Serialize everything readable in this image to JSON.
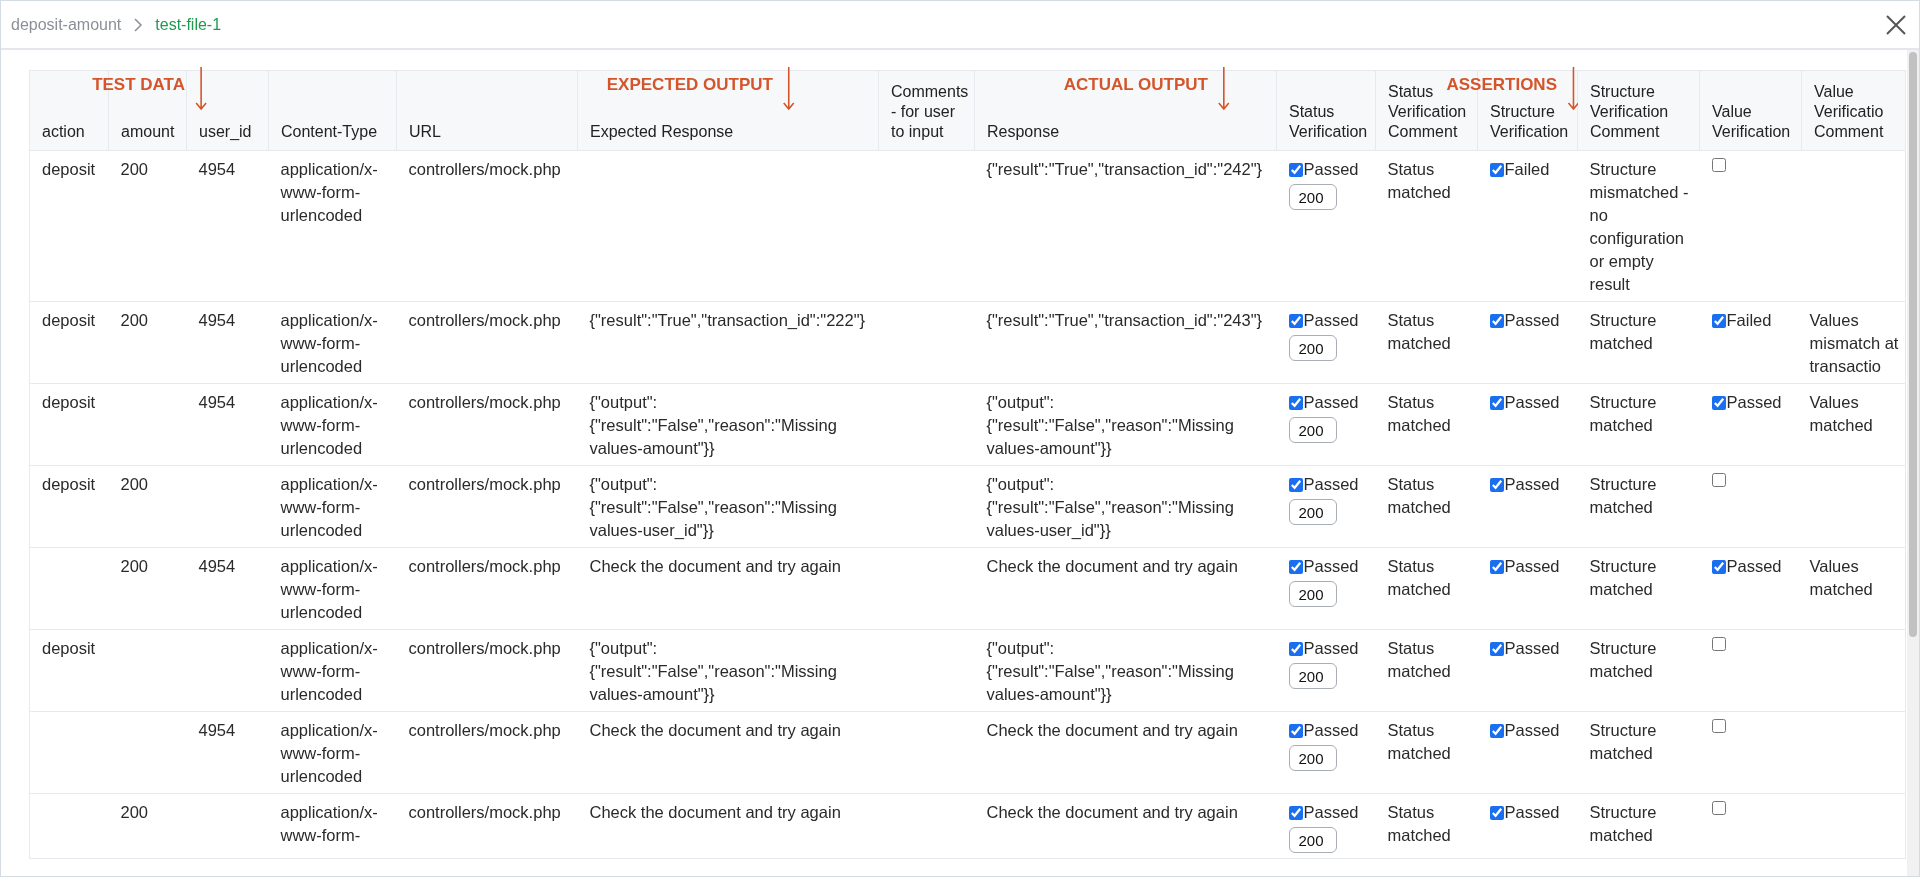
{
  "breadcrumb": {
    "parent": "deposit-amount",
    "current": "test-file-1"
  },
  "annotations": [
    {
      "label": "TEST DATA"
    },
    {
      "label": "EXPECTED OUTPUT"
    },
    {
      "label": "ACTUAL OUTPUT"
    },
    {
      "label": "ASSERTIONS"
    }
  ],
  "table": {
    "columns": [
      {
        "label": "action",
        "kind": "text"
      },
      {
        "label": "amount",
        "kind": "text"
      },
      {
        "label": "user_id",
        "kind": "text"
      },
      {
        "label": "Content-Type",
        "kind": "text"
      },
      {
        "label": "URL",
        "kind": "text"
      },
      {
        "label": "Expected Response",
        "kind": "text"
      },
      {
        "label": "Comments - for user to input",
        "kind": "text"
      },
      {
        "label": "Response",
        "kind": "text"
      },
      {
        "label": "Status Verification",
        "kind": "check"
      },
      {
        "label": "Status Verification Comment",
        "kind": "text"
      },
      {
        "label": "Structure Verification",
        "kind": "check"
      },
      {
        "label": "Structure Verification Comment",
        "kind": "text"
      },
      {
        "label": "Value Verification",
        "kind": "check"
      },
      {
        "label": "Value Verificatio Comment",
        "kind": "text"
      }
    ],
    "rows": [
      {
        "action": "deposit",
        "amount": "200",
        "user_id": "4954",
        "content_type": "application/x-www-form-urlencoded",
        "url": "controllers/mock.php",
        "response": "{\"result\":\"True\",\"transaction_id\":\"242\"}",
        "status_verification": {
          "checked": true,
          "label": "Passed",
          "code": "200"
        },
        "status_comment": "Status matched",
        "structure_verification": {
          "checked": true,
          "label": "Failed"
        },
        "structure_comment": "Structure mismatched - no configuration or empty result",
        "value_verification": {
          "checked": false
        }
      },
      {
        "action": "deposit",
        "amount": "200",
        "user_id": "4954",
        "content_type": "application/x-www-form-urlencoded",
        "url": "controllers/mock.php",
        "expected_response": "{\"result\":\"True\",\"transaction_id\":\"222\"}",
        "response": "{\"result\":\"True\",\"transaction_id\":\"243\"}",
        "status_verification": {
          "checked": true,
          "label": "Passed",
          "code": "200"
        },
        "status_comment": "Status matched",
        "structure_verification": {
          "checked": true,
          "label": "Passed"
        },
        "structure_comment": "Structure matched",
        "value_verification": {
          "checked": true,
          "label": "Failed"
        },
        "value_comment": "Values mismatch at transactio"
      },
      {
        "action": "deposit",
        "user_id": "4954",
        "content_type": "application/x-www-form-urlencoded",
        "url": "controllers/mock.php",
        "expected_response": "{\"output\": {\"result\":\"False\",\"reason\":\"Missing values-amount\"}}",
        "response": "{\"output\": {\"result\":\"False\",\"reason\":\"Missing values-amount\"}}",
        "status_verification": {
          "checked": true,
          "label": "Passed",
          "code": "200"
        },
        "status_comment": "Status matched",
        "structure_verification": {
          "checked": true,
          "label": "Passed"
        },
        "structure_comment": "Structure matched",
        "value_verification": {
          "checked": true,
          "label": "Passed"
        },
        "value_comment": "Values matched"
      },
      {
        "action": "deposit",
        "amount": "200",
        "content_type": "application/x-www-form-urlencoded",
        "url": "controllers/mock.php",
        "expected_response": "{\"output\": {\"result\":\"False\",\"reason\":\"Missing values-user_id\"}}",
        "response": "{\"output\": {\"result\":\"False\",\"reason\":\"Missing values-user_id\"}}",
        "status_verification": {
          "checked": true,
          "label": "Passed",
          "code": "200"
        },
        "status_comment": "Status matched",
        "structure_verification": {
          "checked": true,
          "label": "Passed"
        },
        "structure_comment": "Structure matched",
        "value_verification": {
          "checked": false
        }
      },
      {
        "amount": "200",
        "user_id": "4954",
        "content_type": "application/x-www-form-urlencoded",
        "url": "controllers/mock.php",
        "expected_response": "Check the document and try again",
        "response": "Check the document and try again",
        "status_verification": {
          "checked": true,
          "label": "Passed",
          "code": "200"
        },
        "status_comment": "Status matched",
        "structure_verification": {
          "checked": true,
          "label": "Passed"
        },
        "structure_comment": "Structure matched",
        "value_verification": {
          "checked": true,
          "label": "Passed"
        },
        "value_comment": "Values matched"
      },
      {
        "action": "deposit",
        "content_type": "application/x-www-form-urlencoded",
        "url": "controllers/mock.php",
        "expected_response": "{\"output\": {\"result\":\"False\",\"reason\":\"Missing values-amount\"}}",
        "response": "{\"output\": {\"result\":\"False\",\"reason\":\"Missing values-amount\"}}",
        "status_verification": {
          "checked": true,
          "label": "Passed",
          "code": "200"
        },
        "status_comment": "Status matched",
        "structure_verification": {
          "checked": true,
          "label": "Passed"
        },
        "structure_comment": "Structure matched",
        "value_verification": {
          "checked": false
        }
      },
      {
        "user_id": "4954",
        "content_type": "application/x-www-form-urlencoded",
        "url": "controllers/mock.php",
        "expected_response": "Check the document and try again",
        "response": "Check the document and try again",
        "status_verification": {
          "checked": true,
          "label": "Passed",
          "code": "200"
        },
        "status_comment": "Status matched",
        "structure_verification": {
          "checked": true,
          "label": "Passed"
        },
        "structure_comment": "Structure matched",
        "value_verification": {
          "checked": false
        }
      },
      {
        "amount": "200",
        "content_type": "application/x-www-form-",
        "url": "controllers/mock.php",
        "expected_response": "Check the document and try again",
        "response": "Check the document and try again",
        "status_verification": {
          "checked": true,
          "label": "Passed",
          "code": "200"
        },
        "status_comment": "Status matched",
        "structure_verification": {
          "checked": true,
          "label": "Passed"
        },
        "structure_comment": "Structure matched",
        "value_verification": {
          "checked": false
        }
      }
    ]
  }
}
